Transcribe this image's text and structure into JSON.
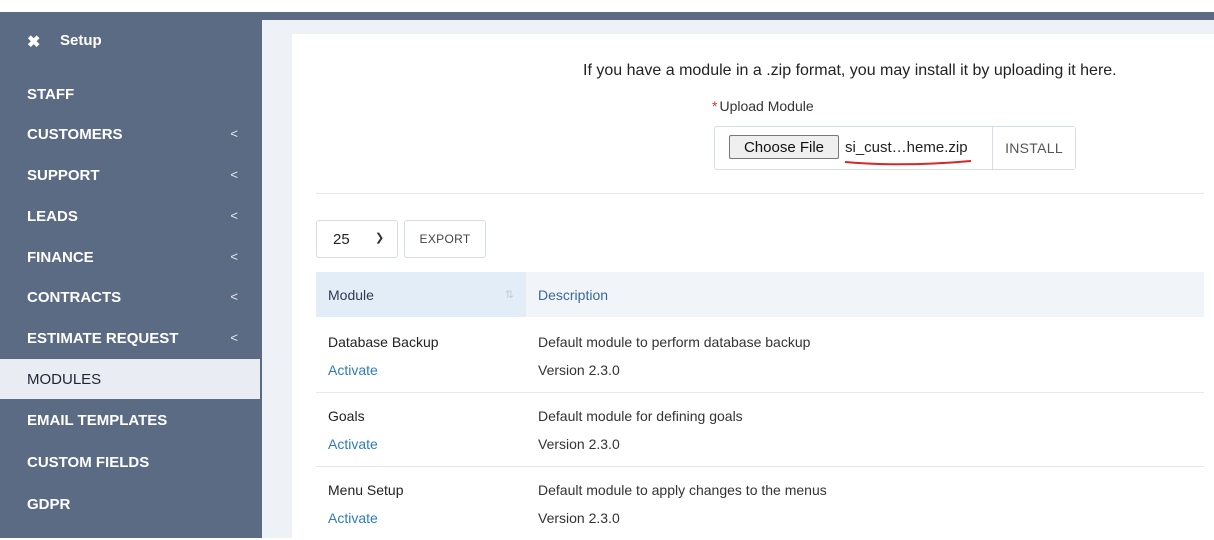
{
  "sidebar": {
    "setup_label": "Setup",
    "items": [
      {
        "label": "STAFF",
        "chevron": false
      },
      {
        "label": "CUSTOMERS",
        "chevron": true
      },
      {
        "label": "SUPPORT",
        "chevron": true
      },
      {
        "label": "LEADS",
        "chevron": true
      },
      {
        "label": "FINANCE",
        "chevron": true
      },
      {
        "label": "CONTRACTS",
        "chevron": true
      },
      {
        "label": "ESTIMATE REQUEST",
        "chevron": true
      },
      {
        "label": "MODULES",
        "chevron": false,
        "active": true
      },
      {
        "label": "EMAIL TEMPLATES",
        "chevron": false
      },
      {
        "label": "CUSTOM FIELDS",
        "chevron": false
      },
      {
        "label": "GDPR",
        "chevron": false
      }
    ],
    "chevron_glyph": "<"
  },
  "upload": {
    "info_text": "If you have a module in a .zip format, you may install it by uploading it here.",
    "required_mark": "*",
    "label": "Upload Module",
    "choose_label": "Choose File",
    "filename": "si_cust…heme.zip",
    "install_label": "INSTALL"
  },
  "toolbar": {
    "per_page": "25",
    "export_label": "EXPORT"
  },
  "table": {
    "headers": {
      "module": "Module",
      "description": "Description"
    },
    "rows": [
      {
        "name": "Database Backup",
        "action": "Activate",
        "description": "Default module to perform database backup",
        "version": "Version 2.3.0"
      },
      {
        "name": "Goals",
        "action": "Activate",
        "description": "Default module for defining goals",
        "version": "Version 2.3.0"
      },
      {
        "name": "Menu Setup",
        "action": "Activate",
        "description": "Default module to apply changes to the menus",
        "version": "Version 2.3.0"
      }
    ]
  },
  "colors": {
    "sidebar_bg": "#5b6b84",
    "active_bg": "#e9edf3",
    "link": "#2f7bbd",
    "required": "#d33333",
    "underline": "#d62828"
  }
}
